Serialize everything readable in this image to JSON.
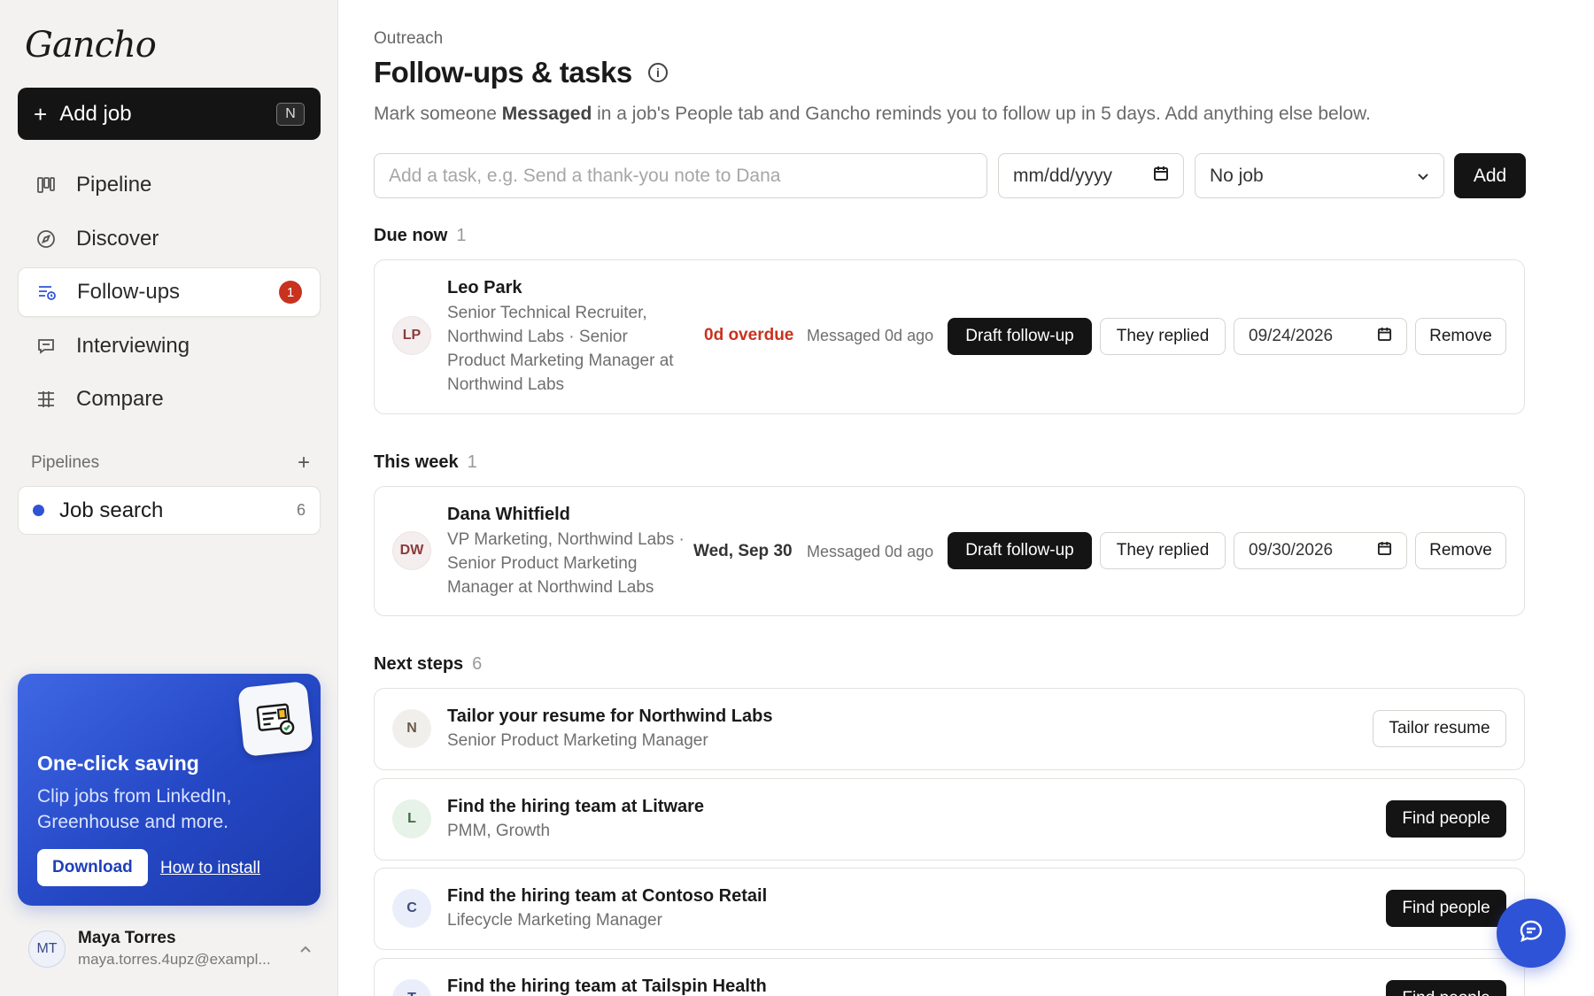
{
  "app": {
    "logo": "Gancho"
  },
  "sidebar": {
    "add_job_label": "Add job",
    "add_job_shortcut": "N",
    "nav": [
      {
        "label": "Pipeline",
        "icon": "kanban-icon"
      },
      {
        "label": "Discover",
        "icon": "compass-icon"
      },
      {
        "label": "Follow-ups",
        "icon": "list-clock-icon",
        "badge": "1",
        "active": true
      },
      {
        "label": "Interviewing",
        "icon": "chat-icon"
      },
      {
        "label": "Compare",
        "icon": "table-icon"
      }
    ],
    "pipelines_heading": "Pipelines",
    "pipelines": [
      {
        "label": "Job search",
        "count": "6",
        "color": "#2f53d6"
      }
    ],
    "promo": {
      "title": "One-click saving",
      "text": "Clip jobs from LinkedIn, Greenhouse and more.",
      "download_label": "Download",
      "install_label": "How to install"
    },
    "user": {
      "initials": "MT",
      "name": "Maya Torres",
      "email": "maya.torres.4upz@exampl..."
    }
  },
  "main": {
    "breadcrumb": "Outreach",
    "title": "Follow-ups & tasks",
    "subtitle_pre": "Mark someone ",
    "subtitle_bold": "Messaged",
    "subtitle_post": " in a job's People tab and Gancho reminds you to follow up in 5 days. Add anything else below.",
    "task_placeholder": "Add a task, e.g. Send a thank-you note to Dana",
    "date_placeholder": "mm/dd/yyyy",
    "job_select_value": "No job",
    "add_label": "Add",
    "sections": {
      "due_now": {
        "label": "Due now",
        "count": "1"
      },
      "this_week": {
        "label": "This week",
        "count": "1"
      },
      "next_steps": {
        "label": "Next steps",
        "count": "6"
      }
    },
    "followups": [
      {
        "initials": "LP",
        "name": "Leo Park",
        "role": "Senior Technical Recruiter, Northwind Labs · Senior Product Marketing Manager at Northwind Labs",
        "status": "0d overdue",
        "messaged": "Messaged 0d ago",
        "draft_label": "Draft follow-up",
        "replied_label": "They replied",
        "date": "09/24/2026",
        "remove_label": "Remove"
      },
      {
        "initials": "DW",
        "name": "Dana Whitfield",
        "role": "VP Marketing, Northwind Labs · Senior Product Marketing Manager at Northwind Labs",
        "status": "Wed, Sep 30",
        "messaged": "Messaged 0d ago",
        "draft_label": "Draft follow-up",
        "replied_label": "They replied",
        "date": "09/30/2026",
        "remove_label": "Remove"
      }
    ],
    "next_steps": [
      {
        "initial": "N",
        "title": "Tailor your resume for Northwind Labs",
        "subtitle": "Senior Product Marketing Manager",
        "action": "Tailor resume"
      },
      {
        "initial": "L",
        "title": "Find the hiring team at Litware",
        "subtitle": "PMM, Growth",
        "action": "Find people"
      },
      {
        "initial": "C",
        "title": "Find the hiring team at Contoso Retail",
        "subtitle": "Lifecycle Marketing Manager",
        "action": "Find people"
      },
      {
        "initial": "T",
        "title": "Find the hiring team at Tailspin Health",
        "subtitle": "",
        "action": "Find people"
      }
    ]
  }
}
